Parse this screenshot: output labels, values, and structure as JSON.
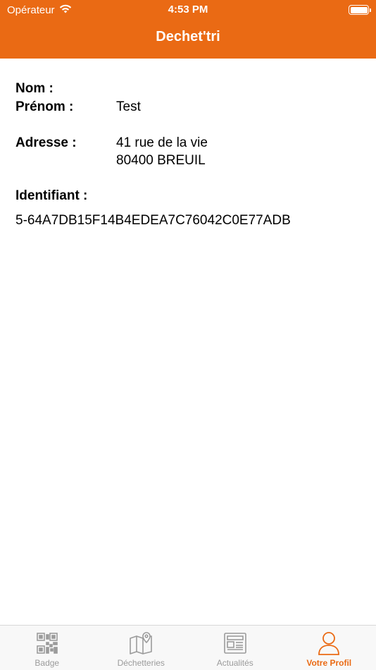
{
  "status_bar": {
    "carrier": "Opérateur",
    "time": "4:53 PM"
  },
  "nav": {
    "title": "Dechet'tri"
  },
  "profile": {
    "nom_label": "Nom :",
    "nom_value": "",
    "prenom_label": "Prénom :",
    "prenom_value": "Test",
    "adresse_label": "Adresse :",
    "adresse_line1": "41  rue de la vie",
    "adresse_line2": "80400 BREUIL",
    "identifiant_label": "Identifiant :",
    "identifiant_value": "5-64A7DB15F14B4EDEA7C76042C0E77ADB"
  },
  "tabs": [
    {
      "label": "Badge",
      "icon": "qr-code-icon"
    },
    {
      "label": "Déchetteries",
      "icon": "map-pin-icon"
    },
    {
      "label": "Actualités",
      "icon": "newspaper-icon"
    },
    {
      "label": "Votre Profil",
      "icon": "user-icon",
      "active": true
    }
  ],
  "colors": {
    "accent": "#EA6A14",
    "tab_inactive": "#9b9b9b"
  }
}
